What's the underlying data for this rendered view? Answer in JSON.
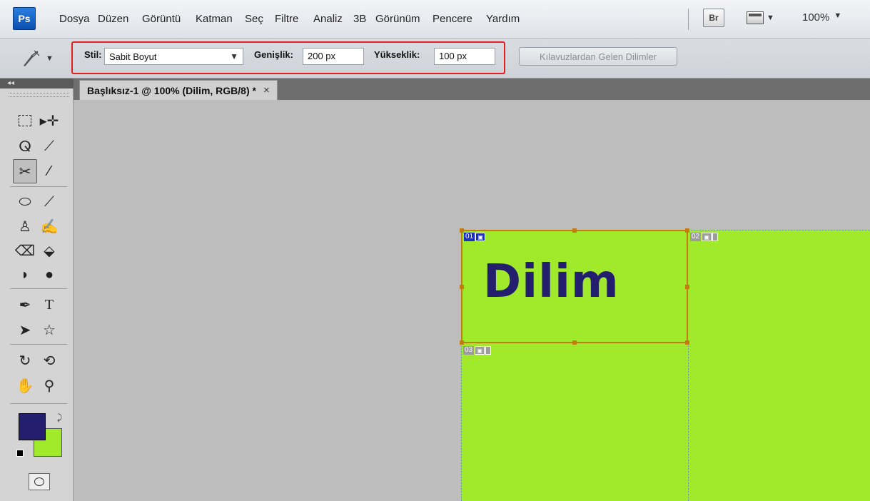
{
  "app": {
    "logo": "Ps",
    "menu": [
      "Dosya",
      "Düzen",
      "Görüntü",
      "Katman",
      "Seç",
      "Filtre",
      "Analiz",
      "3B",
      "Görünüm",
      "Pencere",
      "Yardım"
    ],
    "bridge_label": "Br",
    "zoom": "100%"
  },
  "options": {
    "style_label": "Stil:",
    "style_value": "Sabit Boyut",
    "width_label": "Genişlik:",
    "width_value": "200 px",
    "height_label": "Yükseklik:",
    "height_value": "100 px",
    "guides_button": "Kılavuzlardan Gelen Dilimler"
  },
  "document": {
    "tab_title": "Başlıksız-1 @ 100% (Dilim, RGB/8) *",
    "close": "×",
    "text": "Dilim",
    "slices": [
      {
        "number": "01",
        "type": "user",
        "selected": true
      },
      {
        "number": "02",
        "type": "auto",
        "selected": false
      },
      {
        "number": "03",
        "type": "auto",
        "selected": false
      }
    ]
  },
  "colors": {
    "foreground": "#231f6e",
    "background": "#a1ea2b",
    "slice_border": "#c47b11",
    "highlight": "#e02020"
  },
  "tools": [
    "marquee-icon",
    "move-icon",
    "lasso-icon",
    "quick-select-icon",
    "slice-icon",
    "eyedropper-icon",
    "healing-brush-icon",
    "brush-icon",
    "clone-stamp-icon",
    "history-brush-icon",
    "eraser-icon",
    "paint-bucket-icon",
    "blur-icon",
    "dodge-icon",
    "pen-icon",
    "type-icon",
    "path-select-icon",
    "shape-icon",
    "3d-rotate-icon",
    "3d-orbit-icon",
    "hand-icon",
    "zoom-icon"
  ]
}
